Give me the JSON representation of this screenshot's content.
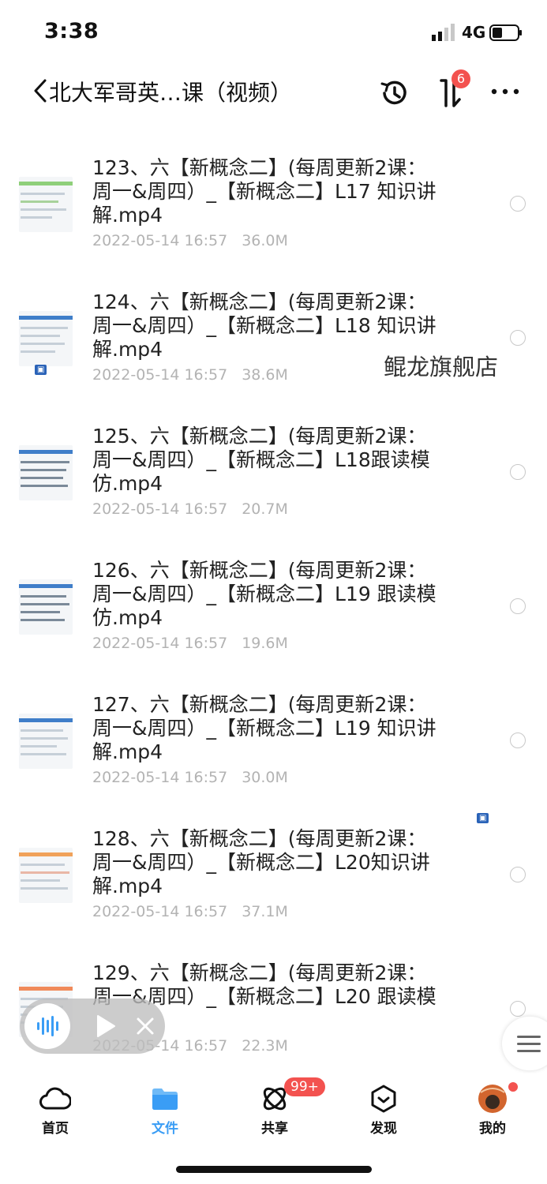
{
  "status_bar": {
    "time": "3:38",
    "network": "4G"
  },
  "header": {
    "title": "北大军哥英…课（视频）",
    "sort_badge": "6"
  },
  "files": [
    {
      "name": "123、六【新概念二】(每周更新2课：周一&周四）_【新概念二】L17 知识讲解.mp4",
      "date": "2022-05-14 16:57",
      "size": "36.0M"
    },
    {
      "name": "124、六【新概念二】(每周更新2课：周一&周四）_【新概念二】L18 知识讲解.mp4",
      "date": "2022-05-14 16:57",
      "size": "38.6M"
    },
    {
      "name": "125、六【新概念二】(每周更新2课：周一&周四）_【新概念二】L18跟读模仿.mp4",
      "date": "2022-05-14 16:57",
      "size": "20.7M"
    },
    {
      "name": "126、六【新概念二】(每周更新2课：周一&周四）_【新概念二】L19 跟读模仿.mp4",
      "date": "2022-05-14 16:57",
      "size": "19.6M"
    },
    {
      "name": "127、六【新概念二】(每周更新2课：周一&周四）_【新概念二】L19 知识讲解.mp4",
      "date": "2022-05-14 16:57",
      "size": "30.0M"
    },
    {
      "name": "128、六【新概念二】(每周更新2课：周一&周四）_【新概念二】L20知识讲解.mp4",
      "date": "2022-05-14 16:57",
      "size": "37.1M"
    },
    {
      "name": "129、六【新概念二】(每周更新2课：周一&周四）_【新概念二】L20 跟读模",
      "date": "2022-05-14 16:57",
      "size": "22.3M"
    }
  ],
  "watermark": {
    "text": "鲲龙旗舰店"
  },
  "bottom_nav": {
    "items": [
      {
        "label": "首页",
        "icon": "cloud-icon"
      },
      {
        "label": "文件",
        "icon": "folder-icon"
      },
      {
        "label": "共享",
        "icon": "share-icon"
      },
      {
        "label": "发现",
        "icon": "discover-icon"
      },
      {
        "label": "我的",
        "icon": "avatar-icon"
      }
    ],
    "share_badge": "99+"
  },
  "colors": {
    "accent": "#3a9df5",
    "badge": "#f3524f",
    "meta_text": "#b3b3b3"
  }
}
